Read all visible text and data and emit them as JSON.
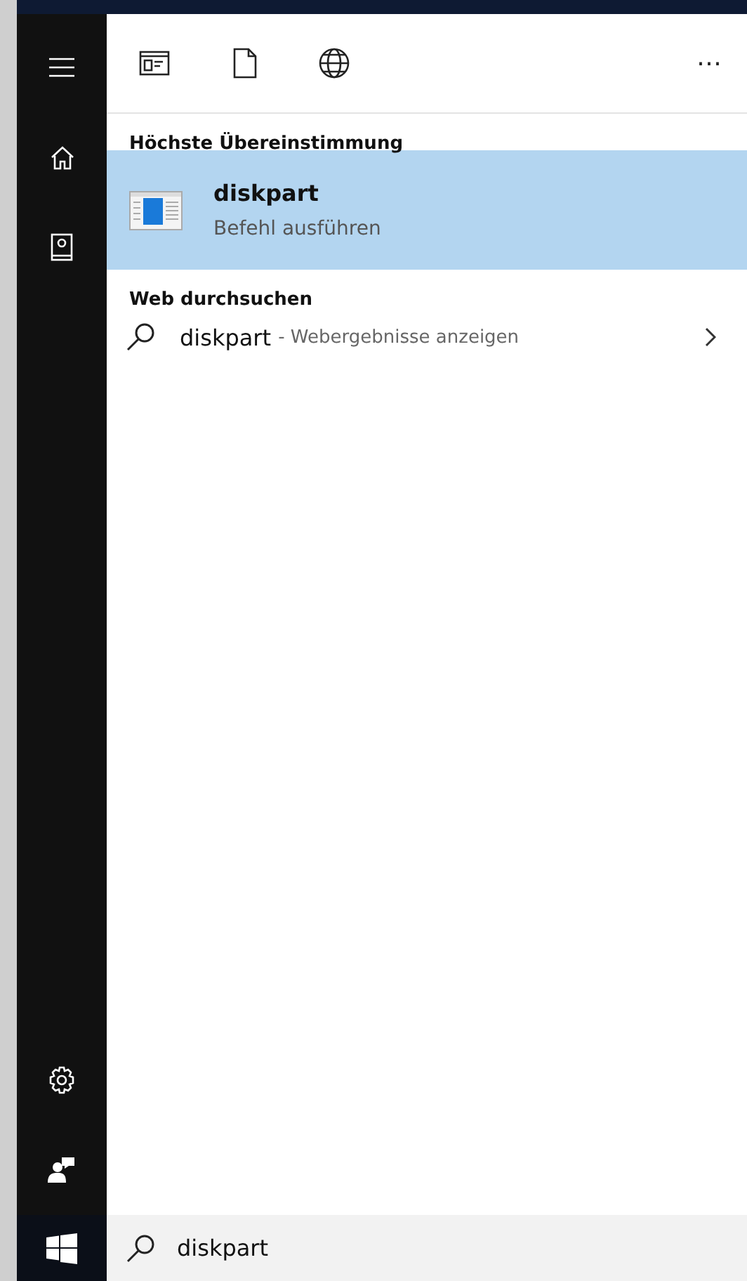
{
  "sidebar": {
    "top_items": [
      {
        "kind": "menu"
      },
      {
        "kind": "home"
      },
      {
        "kind": "notebook"
      }
    ],
    "bottom_items": [
      {
        "kind": "settings"
      },
      {
        "kind": "feedback"
      }
    ],
    "start": {
      "kind": "windows"
    }
  },
  "filter_bar": {
    "filters": [
      {
        "kind": "apps"
      },
      {
        "kind": "documents"
      },
      {
        "kind": "web"
      }
    ],
    "more": "⋯"
  },
  "best_match": {
    "heading": "Höchste Übereinstimmung",
    "items": [
      {
        "title": "diskpart",
        "subtitle": "Befehl ausführen",
        "selected": true
      }
    ]
  },
  "web_search": {
    "heading": "Web durchsuchen",
    "items": [
      {
        "query": "diskpart",
        "hint": "- Webergebnisse anzeigen",
        "selected": false
      }
    ]
  },
  "search_box": {
    "value": "diskpart"
  }
}
